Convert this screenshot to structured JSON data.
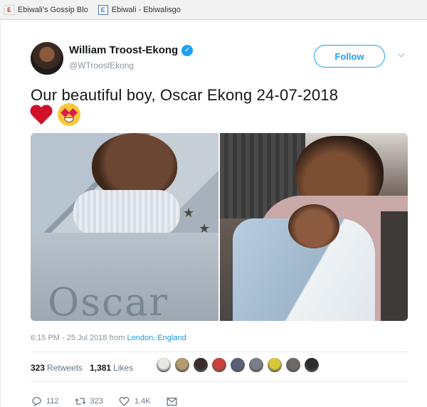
{
  "bookmarks": [
    {
      "label": "Ebiwali's Gossip Blo",
      "icon": "red-e-icon"
    },
    {
      "label": "Ebiwali - Ebiwalisgo",
      "icon": "blue-e-icon"
    }
  ],
  "tweet": {
    "display_name": "William Troost-Ekong",
    "handle": "@WTroostEkong",
    "follow_label": "Follow",
    "text": "Our beautiful boy, Oscar Ekong 24-07-2018",
    "emojis": [
      "red-heart",
      "heart-eyes-face"
    ],
    "photo_text": "Oscar",
    "timestamp": {
      "time": "6:15 PM",
      "separator": "-",
      "date": "25 Jul 2018",
      "from": "from",
      "location": "London, England"
    },
    "stats": {
      "retweets_count": "323",
      "retweets_label": "Retweets",
      "likes_count": "1,381",
      "likes_label": "Likes"
    },
    "likers": [
      "#e9e7e2",
      "#b59a70",
      "#3a2c28",
      "#c9413a",
      "#5b5f7a",
      "#7a7e86",
      "#d9c93a",
      "#6d6a66",
      "#2b2b2b"
    ],
    "actions": {
      "replies": "112",
      "retweets": "323",
      "likes": "1.4K"
    }
  },
  "colors": {
    "accent": "#1da1f2",
    "link": "#1b95e0",
    "muted": "#657786"
  }
}
